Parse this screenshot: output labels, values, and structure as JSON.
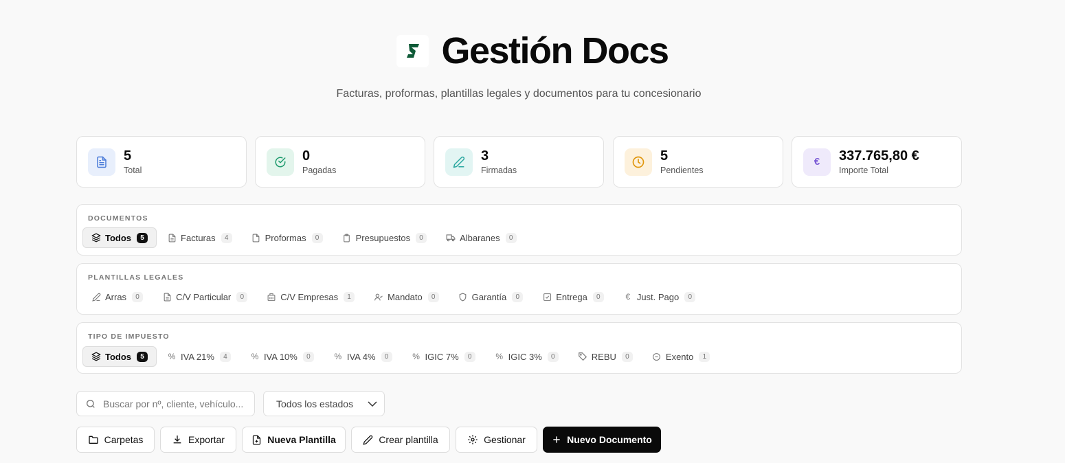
{
  "header": {
    "logo_letter": "S",
    "title": "Gestión Docs",
    "subtitle": "Facturas, proformas, plantillas legales y documentos para tu concesionario"
  },
  "stats": [
    {
      "value": "5",
      "label": "Total",
      "icon": "file-text-icon",
      "color": "#4a7bd8",
      "bg": "#e8effc"
    },
    {
      "value": "0",
      "label": "Pagadas",
      "icon": "check-circle-icon",
      "color": "#1d9a6c",
      "bg": "#e3f5ec"
    },
    {
      "value": "3",
      "label": "Firmadas",
      "icon": "pen-icon",
      "color": "#2aa8a0",
      "bg": "#e2f5f3"
    },
    {
      "value": "5",
      "label": "Pendientes",
      "icon": "clock-icon",
      "color": "#e0960c",
      "bg": "#fdf1dc"
    },
    {
      "value": "337.765,80 €",
      "label": "Importe Total",
      "icon": "euro-icon",
      "color": "#7c5cd6",
      "bg": "#efeafb"
    }
  ],
  "documentos": {
    "title": "DOCUMENTOS",
    "items": [
      {
        "label": "Todos",
        "count": "5",
        "icon": "layers-icon"
      },
      {
        "label": "Facturas",
        "count": "4",
        "icon": "file-text-icon"
      },
      {
        "label": "Proformas",
        "count": "0",
        "icon": "file-icon"
      },
      {
        "label": "Presupuestos",
        "count": "0",
        "icon": "clipboard-icon"
      },
      {
        "label": "Albaranes",
        "count": "0",
        "icon": "truck-icon"
      }
    ]
  },
  "plantillas": {
    "title": "PLANTILLAS LEGALES",
    "items": [
      {
        "label": "Arras",
        "count": "0",
        "icon": "pen-icon"
      },
      {
        "label": "C/V Particular",
        "count": "0",
        "icon": "file-text-icon"
      },
      {
        "label": "C/V Empresas",
        "count": "1",
        "icon": "building-icon"
      },
      {
        "label": "Mandato",
        "count": "0",
        "icon": "user-check-icon"
      },
      {
        "label": "Garantía",
        "count": "0",
        "icon": "shield-icon"
      },
      {
        "label": "Entrega",
        "count": "0",
        "icon": "check-square-icon"
      },
      {
        "label": "Just. Pago",
        "count": "0",
        "icon": "euro-icon"
      }
    ]
  },
  "impuestos": {
    "title": "TIPO DE IMPUESTO",
    "items": [
      {
        "label": "Todos",
        "count": "5",
        "icon": "layers-icon"
      },
      {
        "label": "IVA 21%",
        "count": "4",
        "icon": "percent-icon"
      },
      {
        "label": "IVA 10%",
        "count": "0",
        "icon": "percent-icon"
      },
      {
        "label": "IVA 4%",
        "count": "0",
        "icon": "percent-icon"
      },
      {
        "label": "IGIC 7%",
        "count": "0",
        "icon": "percent-icon"
      },
      {
        "label": "IGIC 3%",
        "count": "0",
        "icon": "percent-icon"
      },
      {
        "label": "REBU",
        "count": "0",
        "icon": "tag-icon"
      },
      {
        "label": "Exento",
        "count": "1",
        "icon": "minus-circle-icon"
      }
    ]
  },
  "search": {
    "placeholder": "Buscar por nº, cliente, vehículo..."
  },
  "status_select": {
    "value": "Todos los estados"
  },
  "actions": {
    "carpetas": "Carpetas",
    "exportar": "Exportar",
    "nueva_plantilla": "Nueva Plantilla",
    "crear_plantilla": "Crear plantilla",
    "gestionar": "Gestionar",
    "nuevo_documento": "Nuevo Documento"
  }
}
